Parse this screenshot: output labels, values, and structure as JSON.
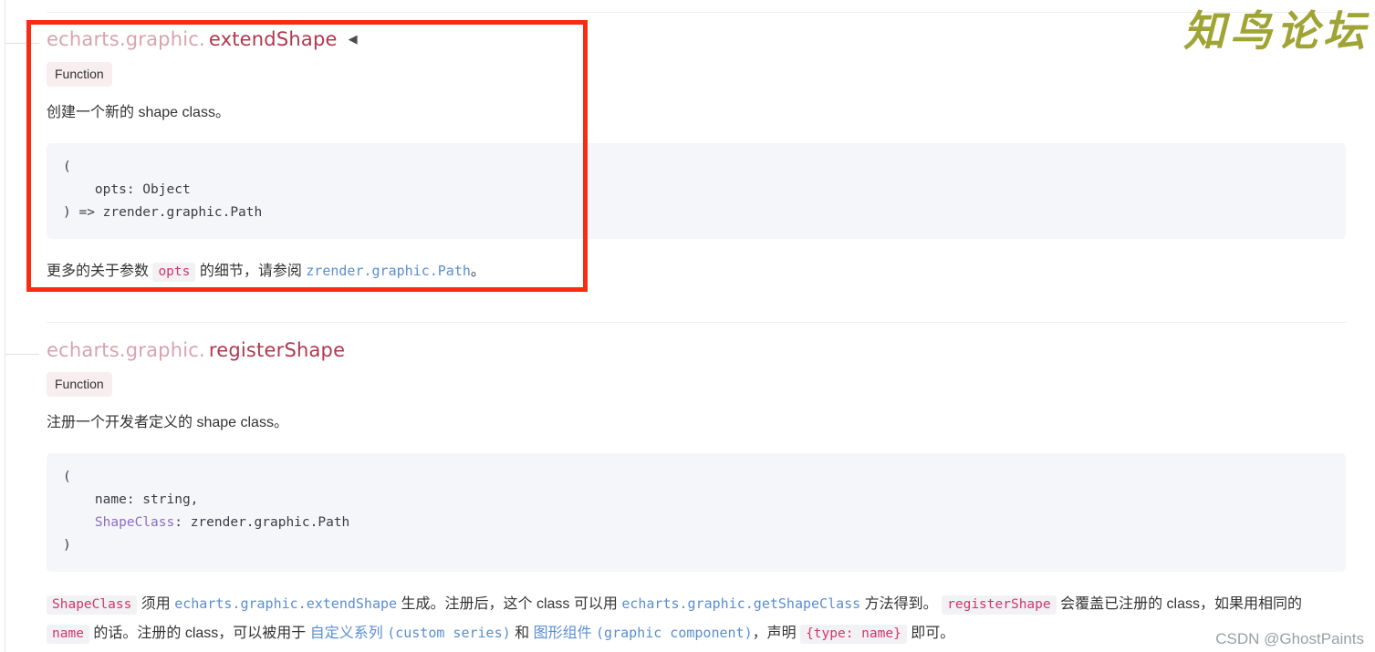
{
  "tree": {
    "guide_label": "tree-indent-guide"
  },
  "sections": [
    {
      "prefix": "echarts.graphic.",
      "name": "extendShape",
      "arrow": "◀",
      "badge": "Function",
      "description": "创建一个新的 shape class。",
      "code": "(\n    opts: Object\n) => zrender.graphic.Path",
      "note": {
        "t1": "更多的关于参数 ",
        "c1": "opts",
        "t2": " 的细节，请参阅 ",
        "l1": "zrender.graphic.Path",
        "t3": "。"
      }
    },
    {
      "prefix": "echarts.graphic.",
      "name": "registerShape",
      "badge": "Function",
      "description": "注册一个开发者定义的 shape class。",
      "code_line1": "(",
      "code_line2": "    name: string,",
      "code_line3_indent": "    ",
      "code_line3_class": "ShapeClass",
      "code_line3_rest": ": zrender.graphic.Path",
      "code_line4": ")",
      "note": {
        "c1": "ShapeClass",
        "t1": " 须用 ",
        "l1": "echarts.graphic.extendShape",
        "t2": " 生成。注册后，这个 class 可以用 ",
        "l2": "echarts.graphic.getShapeClass",
        "t3": " 方法得到。 ",
        "c2": "registerShape",
        "t4": " 会覆盖已注册的 class，如果用相同的 ",
        "c3": "name",
        "t5": " 的话。注册的 class，可以被用于 ",
        "l3": "自定义系列",
        "l3b": "(custom series)",
        "t6": " 和 ",
        "l4": "图形组件",
        "l4b": "(graphic component)",
        "t7": "，声明 ",
        "c4": "{type: name}",
        "t8": " 即可。"
      }
    }
  ],
  "annotation": {
    "label": "highlight-rectangle",
    "color": "#f92b13"
  },
  "watermarks": {
    "top_right": "知鸟论坛",
    "bottom_right": "CSDN @GhostPaints"
  }
}
